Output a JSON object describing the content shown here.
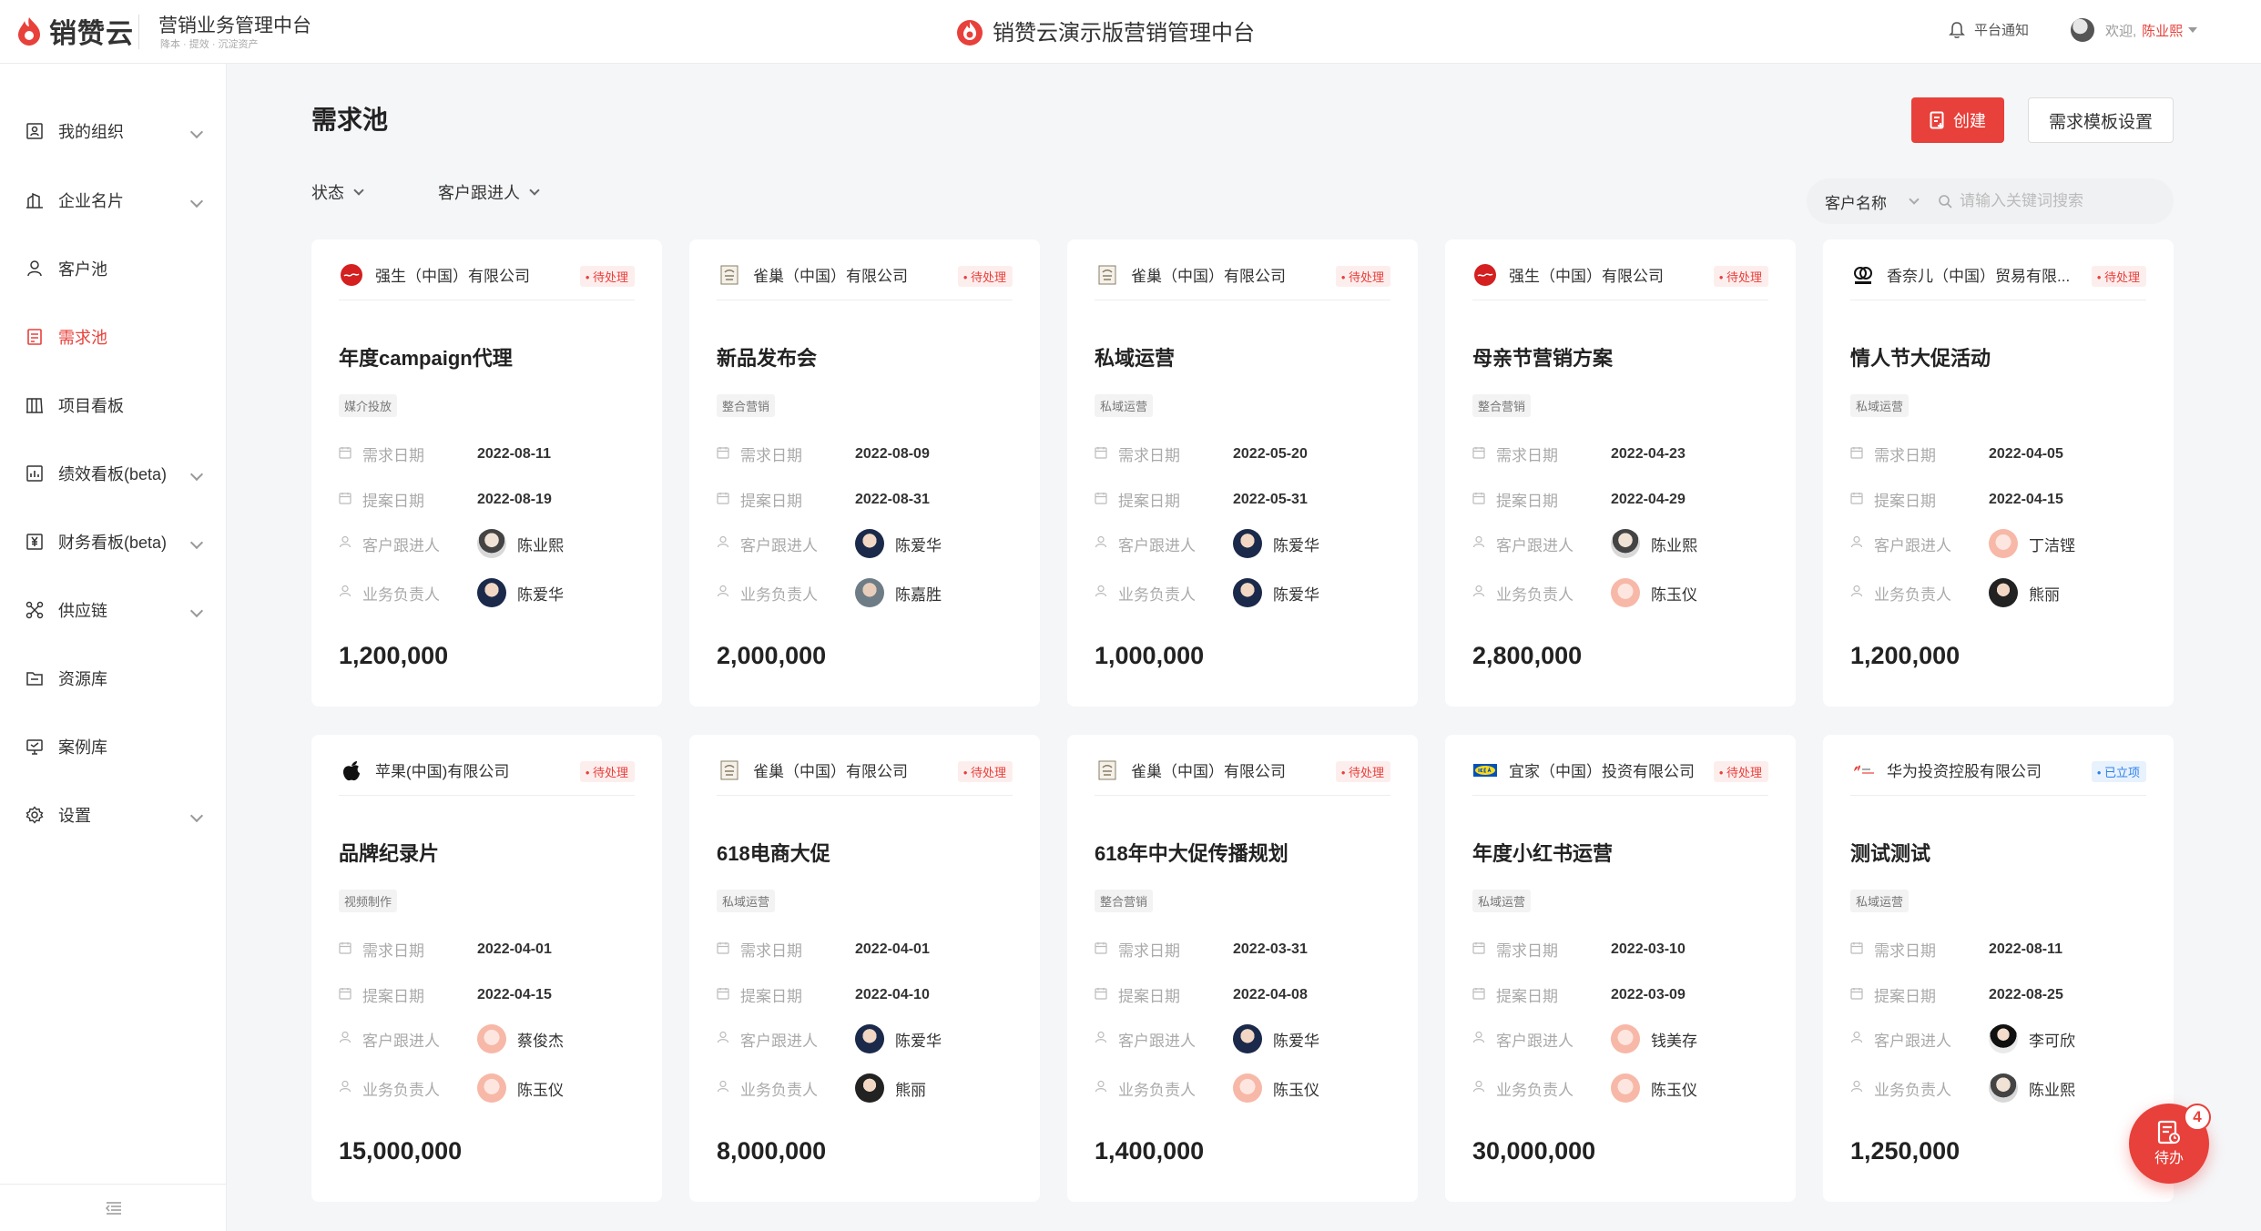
{
  "header": {
    "logo_text": "销赞云",
    "app_title": "营销业务管理中台",
    "app_subtitle": "降本 · 提效 · 沉淀资产",
    "center_title": "销赞云演示版营销管理中台",
    "notice": "平台通知",
    "welcome": "欢迎,",
    "username": "陈业熙"
  },
  "sidebar": {
    "items": [
      {
        "label": "我的组织",
        "icon": "org-icon",
        "chevron": true
      },
      {
        "label": "企业名片",
        "icon": "company-card-icon",
        "chevron": true
      },
      {
        "label": "客户池",
        "icon": "customer-icon",
        "chevron": false
      },
      {
        "label": "需求池",
        "icon": "demand-icon",
        "chevron": false,
        "active": true
      },
      {
        "label": "项目看板",
        "icon": "board-icon",
        "chevron": false
      },
      {
        "label": "绩效看板(beta)",
        "icon": "performance-icon",
        "chevron": true
      },
      {
        "label": "财务看板(beta)",
        "icon": "finance-icon",
        "chevron": true
      },
      {
        "label": "供应链",
        "icon": "supply-chain-icon",
        "chevron": true
      },
      {
        "label": "资源库",
        "icon": "folder-icon",
        "chevron": false
      },
      {
        "label": "案例库",
        "icon": "case-icon",
        "chevron": false
      },
      {
        "label": "设置",
        "icon": "settings-icon",
        "chevron": true
      }
    ]
  },
  "main": {
    "title": "需求池",
    "create_label": "创建",
    "template_label": "需求模板设置",
    "filters": {
      "status": "状态",
      "follower": "客户跟进人"
    },
    "search": {
      "field": "客户名称",
      "placeholder": "请输入关键词搜索"
    },
    "labels": {
      "demand_date": "需求日期",
      "proposal_date": "提案日期",
      "follower": "客户跟进人",
      "owner": "业务负责人"
    },
    "cards": [
      {
        "company": "强生（中国）有限公司",
        "logo": "johnson-logo",
        "status": "待处理",
        "title": "年度campaign代理",
        "tag": "媒介投放",
        "demand_date": "2022-08-11",
        "proposal_date": "2022-08-19",
        "follower": "陈业熙",
        "owner": "陈爱华",
        "amount": "1,200,000"
      },
      {
        "company": "雀巢（中国）有限公司",
        "logo": "nestle-logo",
        "status": "待处理",
        "title": "新品发布会",
        "tag": "整合营销",
        "demand_date": "2022-08-09",
        "proposal_date": "2022-08-31",
        "follower": "陈爱华",
        "owner": "陈嘉胜",
        "amount": "2,000,000"
      },
      {
        "company": "雀巢（中国）有限公司",
        "logo": "nestle-logo",
        "status": "待处理",
        "title": "私域运营",
        "tag": "私域运营",
        "demand_date": "2022-05-20",
        "proposal_date": "2022-05-31",
        "follower": "陈爱华",
        "owner": "陈爱华",
        "amount": "1,000,000"
      },
      {
        "company": "强生（中国）有限公司",
        "logo": "johnson-logo",
        "status": "待处理",
        "title": "母亲节营销方案",
        "tag": "整合营销",
        "demand_date": "2022-04-23",
        "proposal_date": "2022-04-29",
        "follower": "陈业熙",
        "owner": "陈玉仪",
        "amount": "2,800,000"
      },
      {
        "company": "香奈儿（中国）贸易有限...",
        "logo": "chanel-logo",
        "status": "待处理",
        "title": "情人节大促活动",
        "tag": "私域运营",
        "demand_date": "2022-04-05",
        "proposal_date": "2022-04-15",
        "follower": "丁洁铿",
        "owner": "熊丽",
        "amount": "1,200,000"
      },
      {
        "company": "苹果(中国)有限公司",
        "logo": "apple-logo",
        "status": "待处理",
        "title": "品牌纪录片",
        "tag": "视频制作",
        "demand_date": "2022-04-01",
        "proposal_date": "2022-04-15",
        "follower": "蔡俊杰",
        "owner": "陈玉仪",
        "amount": "15,000,000"
      },
      {
        "company": "雀巢（中国）有限公司",
        "logo": "nestle-logo",
        "status": "待处理",
        "title": "618电商大促",
        "tag": "私域运营",
        "demand_date": "2022-04-01",
        "proposal_date": "2022-04-10",
        "follower": "陈爱华",
        "owner": "熊丽",
        "amount": "8,000,000"
      },
      {
        "company": "雀巢（中国）有限公司",
        "logo": "nestle-logo",
        "status": "待处理",
        "title": "618年中大促传播规划",
        "tag": "整合营销",
        "demand_date": "2022-03-31",
        "proposal_date": "2022-04-08",
        "follower": "陈爱华",
        "owner": "陈玉仪",
        "amount": "1,400,000"
      },
      {
        "company": "宜家（中国）投资有限公司",
        "logo": "ikea-logo",
        "status": "待处理",
        "title": "年度小红书运营",
        "tag": "私域运营",
        "demand_date": "2022-03-10",
        "proposal_date": "2022-03-09",
        "follower": "钱美存",
        "owner": "陈玉仪",
        "amount": "30,000,000"
      },
      {
        "company": "华为投资控股有限公司",
        "logo": "huawei-logo",
        "status": "已立项",
        "status_color": "blue",
        "title": "测试测试",
        "tag": "私域运营",
        "demand_date": "2022-08-11",
        "proposal_date": "2022-08-25",
        "follower": "李可欣",
        "owner": "陈业熙",
        "amount": "1,250,000"
      }
    ]
  },
  "todo": {
    "label": "待办",
    "count": "4"
  },
  "colors": {
    "accent": "#e8403a",
    "blue": "#2f80ed"
  }
}
